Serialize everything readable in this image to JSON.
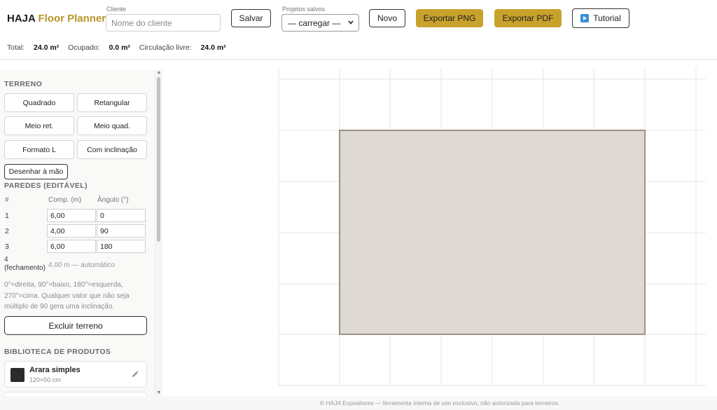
{
  "brand": {
    "name": "HAJA",
    "accent": "Floor Planner"
  },
  "header": {
    "client_label": "Cliente",
    "client_placeholder": "Nome do cliente",
    "client_value": "",
    "save_label": "Salvar",
    "saved_projects_label": "Projetos salvos",
    "saved_projects_selected": "— carregar —",
    "new_label": "Novo",
    "export_png_label": "Exportar PNG",
    "export_pdf_label": "Exportar PDF",
    "tutorial_label": "Tutorial"
  },
  "stats": {
    "total_label": "Total:",
    "total_value": "24.0 m²",
    "occupied_label": "Ocupado:",
    "occupied_value": "0.0 m²",
    "free_label": "Circulação livre:",
    "free_value": "24.0 m²"
  },
  "sidebar": {
    "terrain_title": "TERRENO",
    "shapes": [
      "Quadrado",
      "Retangular",
      "Meio ret.",
      "Meio quad.",
      "Formato L",
      "Com inclinação"
    ],
    "draw_label": "Desenhar à mão",
    "walls_title": "PAREDES (EDITÁVEL)",
    "walls_headers": {
      "num": "#",
      "length": "Comp. (m)",
      "angle": "Ângulo (°)"
    },
    "walls": [
      {
        "num": "1",
        "length": "6,00",
        "angle": "0"
      },
      {
        "num": "2",
        "length": "4,00",
        "angle": "90"
      },
      {
        "num": "3",
        "length": "6,00",
        "angle": "180"
      }
    ],
    "closing_num": "4",
    "closing_label": "(fechamento)",
    "closing_auto": "4.00 m — automático",
    "help_text": "0°=direita, 90°=baixo, 180°=esquerda, 270°=cima. Qualquer valor que não seja múltiplo de 90 gera uma inclinação.",
    "delete_label": "Excluir terreno",
    "library_title": "BIBLIOTECA DE PRODUTOS",
    "products": [
      {
        "name": "Arara simples",
        "size": "120×50 cm",
        "icon": "pencil-icon"
      }
    ]
  },
  "footer": {
    "text": "© HAJA Expositores — ferramenta interna de uso exclusivo, não autorizada para terceiros."
  },
  "colors": {
    "accent": "#c9a22c",
    "floor_fill": "#dedad3",
    "floor_stroke": "#9c917f",
    "grid": "#e6e6e6"
  }
}
